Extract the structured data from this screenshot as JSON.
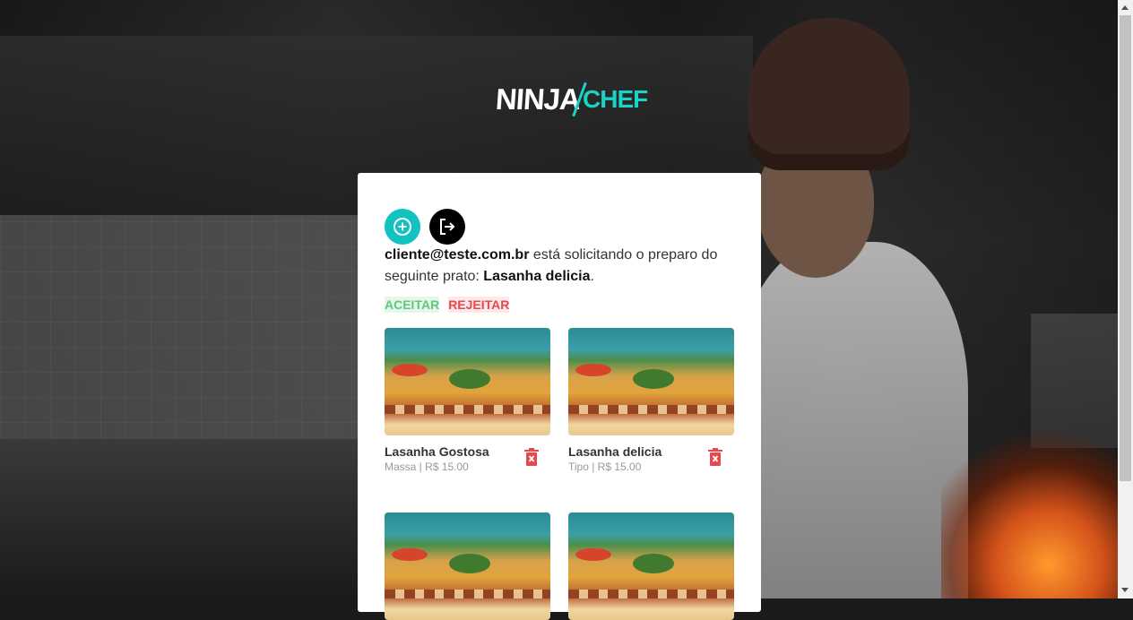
{
  "logo": {
    "part1": "NINJA",
    "part2": "CHEF",
    "accent_color": "#1bd3c4"
  },
  "card": {
    "add_icon": "plus-circle-icon",
    "logout_icon": "logout-icon",
    "request": {
      "user": "cliente@teste.com.br",
      "text": " está solicitando o preparo do seguinte prato: ",
      "dish": "Lasanha delicia",
      "end": "."
    },
    "actions": {
      "accept": "ACEITAR",
      "reject": "REJEITAR"
    }
  },
  "dishes": [
    {
      "name": "Lasanha Gostosa",
      "meta": "Massa | R$ 15.00"
    },
    {
      "name": "Lasanha delicia",
      "meta": "Tipo | R$ 15.00"
    },
    {
      "name": "",
      "meta": ""
    },
    {
      "name": "",
      "meta": ""
    }
  ],
  "colors": {
    "primary": "#12c2c0",
    "danger": "#e5484d",
    "success": "#5bc97a"
  }
}
